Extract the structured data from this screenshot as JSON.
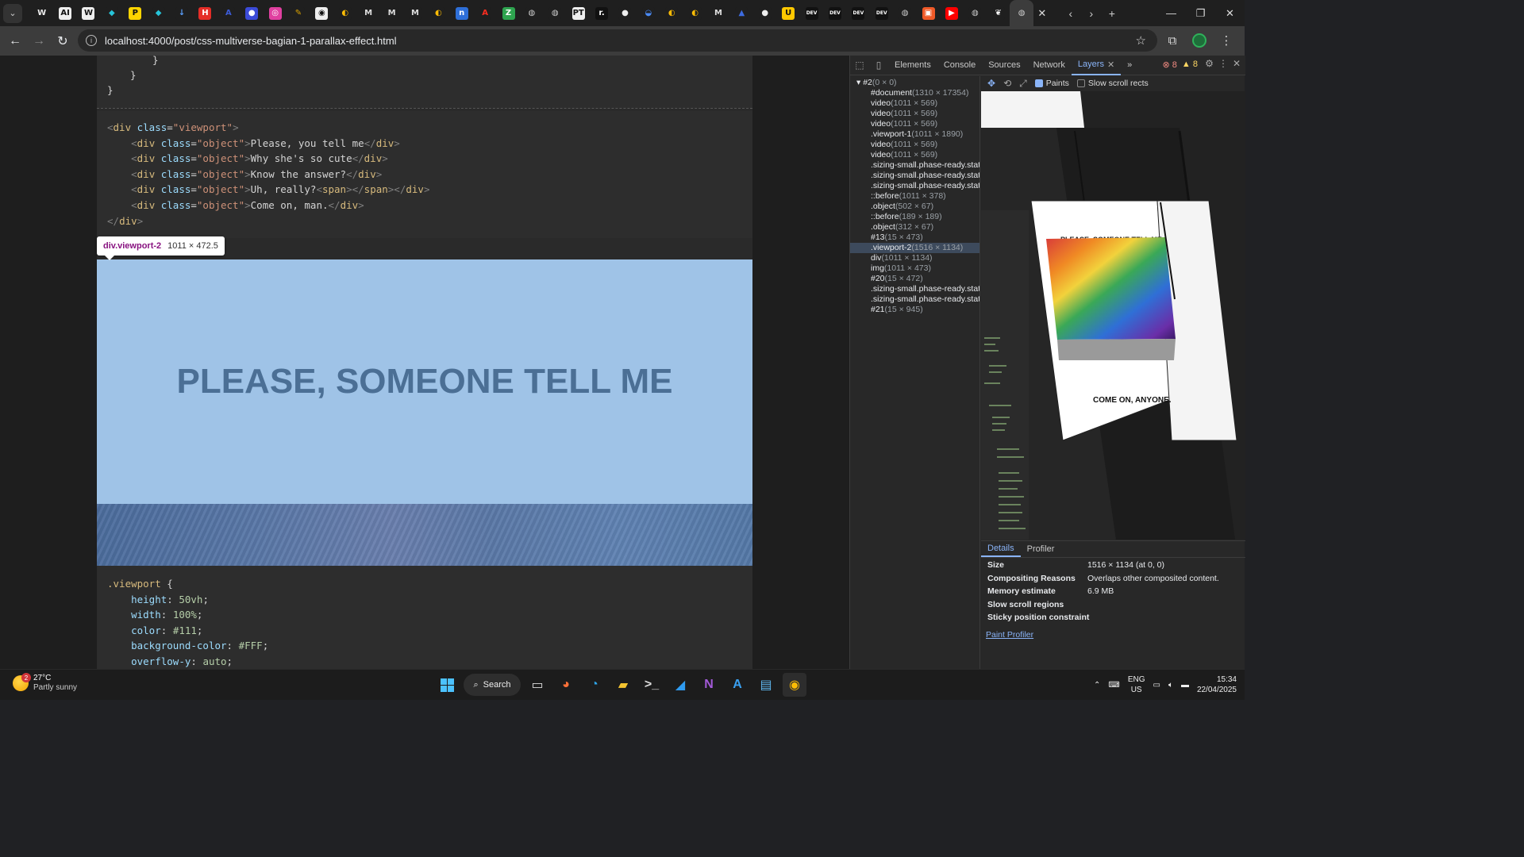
{
  "browser": {
    "tab_dropdown_icon": "chevron-down-icon",
    "favicons": [
      {
        "name": "w-icon",
        "glyph": "W",
        "bg": "#1f1f1f",
        "fg": "#eee"
      },
      {
        "name": "ai-icon",
        "glyph": "AI",
        "bg": "#eee",
        "fg": "#111"
      },
      {
        "name": "w-box-icon",
        "glyph": "W",
        "bg": "#eee",
        "fg": "#111"
      },
      {
        "name": "cube-icon",
        "glyph": "◆",
        "bg": "#1f1f1f",
        "fg": "#27c4d9"
      },
      {
        "name": "p-icon",
        "glyph": "P",
        "bg": "#ffd400",
        "fg": "#111"
      },
      {
        "name": "cube2-icon",
        "glyph": "◆",
        "bg": "#1f1f1f",
        "fg": "#27c4d9"
      },
      {
        "name": "download-icon",
        "glyph": "↓",
        "bg": "#1f1f1f",
        "fg": "#5aa0ff"
      },
      {
        "name": "h-icon",
        "glyph": "H",
        "bg": "#e52d27",
        "fg": "#fff"
      },
      {
        "name": "a-icon",
        "glyph": "A",
        "bg": "#1f1f1f",
        "fg": "#3c5bd6"
      },
      {
        "name": "circle-icon",
        "glyph": "●",
        "bg": "#3b4bd8",
        "fg": "#fff"
      },
      {
        "name": "pink-icon",
        "glyph": "◎",
        "bg": "#e040a0",
        "fg": "#fff"
      },
      {
        "name": "pen-icon",
        "glyph": "✎",
        "bg": "#1f1f1f",
        "fg": "#d9a200"
      },
      {
        "name": "camera-icon",
        "glyph": "◉",
        "bg": "#eee",
        "fg": "#111"
      },
      {
        "name": "chrome-icon",
        "glyph": "◐",
        "bg": "#1f1f1f",
        "fg": "#fbbc05"
      },
      {
        "name": "medium-icon",
        "glyph": "M",
        "bg": "#1f1f1f",
        "fg": "#ddd"
      },
      {
        "name": "medium2-icon",
        "glyph": "M",
        "bg": "#1f1f1f",
        "fg": "#ddd"
      },
      {
        "name": "medium3-icon",
        "glyph": "M",
        "bg": "#1f1f1f",
        "fg": "#ddd"
      },
      {
        "name": "chrome2-icon",
        "glyph": "◐",
        "bg": "#1f1f1f",
        "fg": "#fbbc05"
      },
      {
        "name": "n-icon",
        "glyph": "n",
        "bg": "#2e6fd8",
        "fg": "#fff"
      },
      {
        "name": "adobe-icon",
        "glyph": "A",
        "bg": "#1f1f1f",
        "fg": "#ff2d20"
      },
      {
        "name": "z-icon",
        "glyph": "Z",
        "bg": "#2ea44f",
        "fg": "#fff"
      },
      {
        "name": "globe-icon",
        "glyph": "◍",
        "bg": "#1f1f1f",
        "fg": "#ccc"
      },
      {
        "name": "globe2-icon",
        "glyph": "◍",
        "bg": "#1f1f1f",
        "fg": "#ccc"
      },
      {
        "name": "pt-icon",
        "glyph": "PT",
        "bg": "#eee",
        "fg": "#111"
      },
      {
        "name": "r-icon",
        "glyph": "r.",
        "bg": "#111",
        "fg": "#fff"
      },
      {
        "name": "github-icon",
        "glyph": "●",
        "bg": "#1f1f1f",
        "fg": "#eee"
      },
      {
        "name": "swirl-icon",
        "glyph": "◒",
        "bg": "#1f1f1f",
        "fg": "#4a8af4"
      },
      {
        "name": "chrome3-icon",
        "glyph": "◐",
        "bg": "#1f1f1f",
        "fg": "#fbbc05"
      },
      {
        "name": "chrome4-icon",
        "glyph": "◐",
        "bg": "#1f1f1f",
        "fg": "#fbbc05"
      },
      {
        "name": "medium4-icon",
        "glyph": "M",
        "bg": "#1f1f1f",
        "fg": "#ddd"
      },
      {
        "name": "person-icon",
        "glyph": "▲",
        "bg": "#1f1f1f",
        "fg": "#3d6be0"
      },
      {
        "name": "github2-icon",
        "glyph": "●",
        "bg": "#1f1f1f",
        "fg": "#eee"
      },
      {
        "name": "u-icon",
        "glyph": "U",
        "bg": "#ffc800",
        "fg": "#111"
      },
      {
        "name": "dev-icon",
        "glyph": "DEV",
        "bg": "#111",
        "fg": "#fff"
      },
      {
        "name": "dev2-icon",
        "glyph": "DEV",
        "bg": "#111",
        "fg": "#fff"
      },
      {
        "name": "dev3-icon",
        "glyph": "DEV",
        "bg": "#111",
        "fg": "#fff"
      },
      {
        "name": "dev4-icon",
        "glyph": "DEV",
        "bg": "#111",
        "fg": "#fff"
      },
      {
        "name": "globe3-icon",
        "glyph": "◍",
        "bg": "#1f1f1f",
        "fg": "#ccc"
      },
      {
        "name": "orange-icon",
        "glyph": "▣",
        "bg": "#f05a28",
        "fg": "#fff"
      },
      {
        "name": "youtube-icon",
        "glyph": "▶",
        "bg": "#ff0000",
        "fg": "#fff"
      },
      {
        "name": "globe4-icon",
        "glyph": "◍",
        "bg": "#1f1f1f",
        "fg": "#ccc"
      },
      {
        "name": "feather-icon",
        "glyph": "❦",
        "bg": "#1f1f1f",
        "fg": "#fff"
      },
      {
        "name": "globe5-icon",
        "glyph": "◍",
        "bg": "#3c3c3c",
        "fg": "#ccc",
        "active": true
      }
    ],
    "close_tab_glyph": "✕",
    "tab_nav": [
      "‹",
      "›",
      "+"
    ],
    "window_controls": [
      "—",
      "❐",
      "✕"
    ],
    "url": "localhost:4000/post/css-multiverse-bagian-1-parallax-effect.html",
    "back_glyph": "←",
    "forward_glyph": "→",
    "reload_glyph": "↻",
    "info_glyph": "i",
    "star_glyph": "☆",
    "extension_glyph": "⧉",
    "menu_glyph": "⋮"
  },
  "page": {
    "code_top": [
      "}",
      "}",
      "}"
    ],
    "code_html": [
      {
        "indent": "",
        "parts": [
          [
            "tag",
            "<"
          ],
          [
            "tname",
            "div"
          ],
          [
            "attr",
            " class"
          ],
          [
            "txt",
            "="
          ],
          [
            "str",
            "\"viewport\""
          ],
          [
            "tag",
            ">"
          ]
        ]
      },
      {
        "indent": "    ",
        "parts": [
          [
            "tag",
            "<"
          ],
          [
            "tname",
            "div"
          ],
          [
            "attr",
            " class"
          ],
          [
            "txt",
            "="
          ],
          [
            "str",
            "\"object\""
          ],
          [
            "tag",
            ">"
          ],
          [
            "txt",
            "Please, you tell me"
          ],
          [
            "tag",
            "</"
          ],
          [
            "tname",
            "div"
          ],
          [
            "tag",
            ">"
          ]
        ]
      },
      {
        "indent": "    ",
        "parts": [
          [
            "tag",
            "<"
          ],
          [
            "tname",
            "div"
          ],
          [
            "attr",
            " class"
          ],
          [
            "txt",
            "="
          ],
          [
            "str",
            "\"object\""
          ],
          [
            "tag",
            ">"
          ],
          [
            "txt",
            "Why she's so cute"
          ],
          [
            "tag",
            "</"
          ],
          [
            "tname",
            "div"
          ],
          [
            "tag",
            ">"
          ]
        ]
      },
      {
        "indent": "    ",
        "parts": [
          [
            "tag",
            "<"
          ],
          [
            "tname",
            "div"
          ],
          [
            "attr",
            " class"
          ],
          [
            "txt",
            "="
          ],
          [
            "str",
            "\"object\""
          ],
          [
            "tag",
            ">"
          ],
          [
            "txt",
            "Know the answer?"
          ],
          [
            "tag",
            "</"
          ],
          [
            "tname",
            "div"
          ],
          [
            "tag",
            ">"
          ]
        ]
      },
      {
        "indent": "    ",
        "parts": [
          [
            "tag",
            "<"
          ],
          [
            "tname",
            "div"
          ],
          [
            "attr",
            " class"
          ],
          [
            "txt",
            "="
          ],
          [
            "str",
            "\"object\""
          ],
          [
            "tag",
            ">"
          ],
          [
            "txt",
            "Uh, really?"
          ],
          [
            "tag",
            "<"
          ],
          [
            "tname",
            "span"
          ],
          [
            "tag",
            "></"
          ],
          [
            "tname",
            "span"
          ],
          [
            "tag",
            "></"
          ],
          [
            "tname",
            "div"
          ],
          [
            "tag",
            ">"
          ]
        ]
      },
      {
        "indent": "    ",
        "parts": [
          [
            "tag",
            "<"
          ],
          [
            "tname",
            "div"
          ],
          [
            "attr",
            " class"
          ],
          [
            "txt",
            "="
          ],
          [
            "str",
            "\"object\""
          ],
          [
            "tag",
            ">"
          ],
          [
            "txt",
            "Come on, man."
          ],
          [
            "tag",
            "</"
          ],
          [
            "tname",
            "div"
          ],
          [
            "tag",
            ">"
          ]
        ]
      },
      {
        "indent": "",
        "parts": [
          [
            "tag",
            "</"
          ],
          [
            "tname",
            "div"
          ],
          [
            "tag",
            ">"
          ]
        ]
      }
    ],
    "tooltip_selector": "div.viewport-2",
    "tooltip_size": "1011 × 472.5",
    "banner_text": "PLEASE, SOMEONE TELL ME",
    "code_css": [
      {
        "indent": "",
        "parts": [
          [
            "sel3",
            ".viewport"
          ],
          [
            "punc",
            " {"
          ]
        ]
      },
      {
        "indent": "    ",
        "parts": [
          [
            "prop",
            "height"
          ],
          [
            "punc",
            ": "
          ],
          [
            "val",
            "50vh"
          ],
          [
            "punc",
            ";"
          ]
        ]
      },
      {
        "indent": "    ",
        "parts": [
          [
            "prop",
            "width"
          ],
          [
            "punc",
            ": "
          ],
          [
            "val",
            "100%"
          ],
          [
            "punc",
            ";"
          ]
        ]
      },
      {
        "indent": "    ",
        "parts": [
          [
            "prop",
            "color"
          ],
          [
            "punc",
            ": "
          ],
          [
            "val",
            "#111"
          ],
          [
            "punc",
            ";"
          ]
        ]
      },
      {
        "indent": "    ",
        "parts": [
          [
            "prop",
            "background-color"
          ],
          [
            "punc",
            ": "
          ],
          [
            "val",
            "#FFF"
          ],
          [
            "punc",
            ";"
          ]
        ]
      },
      {
        "indent": "    ",
        "parts": [
          [
            "prop",
            "overflow-y"
          ],
          [
            "punc",
            ": "
          ],
          [
            "val",
            "auto"
          ],
          [
            "punc",
            ";"
          ]
        ]
      }
    ]
  },
  "devtools": {
    "tabs": [
      "Elements",
      "Console",
      "Sources",
      "Network",
      "Layers"
    ],
    "active_tab": "Layers",
    "more_tabs": "»",
    "errors": "8",
    "warnings": "8",
    "layer_tree": [
      {
        "name": "#2",
        "dim": "(0 × 0)",
        "root": true
      },
      {
        "name": "#document",
        "dim": "(1310 × 17354)"
      },
      {
        "name": "video",
        "dim": "(1011 × 569)"
      },
      {
        "name": "video",
        "dim": "(1011 × 569)"
      },
      {
        "name": "video",
        "dim": "(1011 × 569)"
      },
      {
        "name": ".viewport-1",
        "dim": "(1011 × 1890)"
      },
      {
        "name": "video",
        "dim": "(1011 × 569)"
      },
      {
        "name": "video",
        "dim": "(1011 × 569)"
      },
      {
        "name": ".sizing-small.phase-ready.state-",
        "dim": ""
      },
      {
        "name": ".sizing-small.phase-ready.state-",
        "dim": ""
      },
      {
        "name": ".sizing-small.phase-ready.state-",
        "dim": ""
      },
      {
        "name": "::before",
        "dim": "(1011 × 378)"
      },
      {
        "name": ".object",
        "dim": "(502 × 67)"
      },
      {
        "name": "::before",
        "dim": "(189 × 189)"
      },
      {
        "name": ".object",
        "dim": "(312 × 67)"
      },
      {
        "name": "#13",
        "dim": "(15 × 473)"
      },
      {
        "name": ".viewport-2",
        "dim": "(1516 × 1134)",
        "selected": true
      },
      {
        "name": "div",
        "dim": "(1011 × 1134)"
      },
      {
        "name": "img",
        "dim": "(1011 × 473)"
      },
      {
        "name": "#20",
        "dim": "(15 × 472)"
      },
      {
        "name": ".sizing-small.phase-ready.state-",
        "dim": ""
      },
      {
        "name": ".sizing-small.phase-ready.state-",
        "dim": ""
      },
      {
        "name": "#21",
        "dim": "(15 × 945)"
      }
    ],
    "paints_label": "Paints",
    "slow_scroll_label": "Slow scroll rects",
    "canvas_text_top": "PLEASE, SOMEONE TELL ME",
    "canvas_text_bottom": "COME ON, ANYONE.",
    "details_tabs": [
      "Details",
      "Profiler"
    ],
    "details": [
      {
        "k": "Size",
        "v": "1516 × 1134 (at 0, 0)"
      },
      {
        "k": "Compositing Reasons",
        "v": "Overlaps other composited content."
      },
      {
        "k": "Memory estimate",
        "v": "6.9 MB"
      },
      {
        "k": "Slow scroll regions",
        "v": ""
      },
      {
        "k": "Sticky position constraint",
        "v": ""
      }
    ],
    "paint_profiler_link": "Paint Profiler"
  },
  "taskbar": {
    "temp": "27°C",
    "weather": "Partly sunny",
    "weather_badge": "2",
    "search_label": "Search",
    "apps": [
      {
        "name": "task-view-icon",
        "glyph": "▭",
        "color": "#ddd"
      },
      {
        "name": "firefox-icon",
        "glyph": "◕",
        "color": "#ff7139"
      },
      {
        "name": "edge-icon",
        "glyph": "◔",
        "color": "#2ea5e8"
      },
      {
        "name": "explorer-icon",
        "glyph": "▰",
        "color": "#f4c430"
      },
      {
        "name": "terminal-icon",
        "glyph": ">_",
        "color": "#ddd"
      },
      {
        "name": "vscode-icon",
        "glyph": "◢",
        "color": "#2f9bf0"
      },
      {
        "name": "onenote-icon",
        "glyph": "N",
        "color": "#a35ad8"
      },
      {
        "name": "azure-icon",
        "glyph": "A",
        "color": "#3aa0f0"
      },
      {
        "name": "notepad-icon",
        "glyph": "▤",
        "color": "#5fb8f0"
      },
      {
        "name": "chrome-icon",
        "glyph": "◉",
        "color": "#fbbc05",
        "active": true
      }
    ],
    "lang_top": "ENG",
    "lang_bottom": "US",
    "time": "15:34",
    "date": "22/04/2025"
  }
}
